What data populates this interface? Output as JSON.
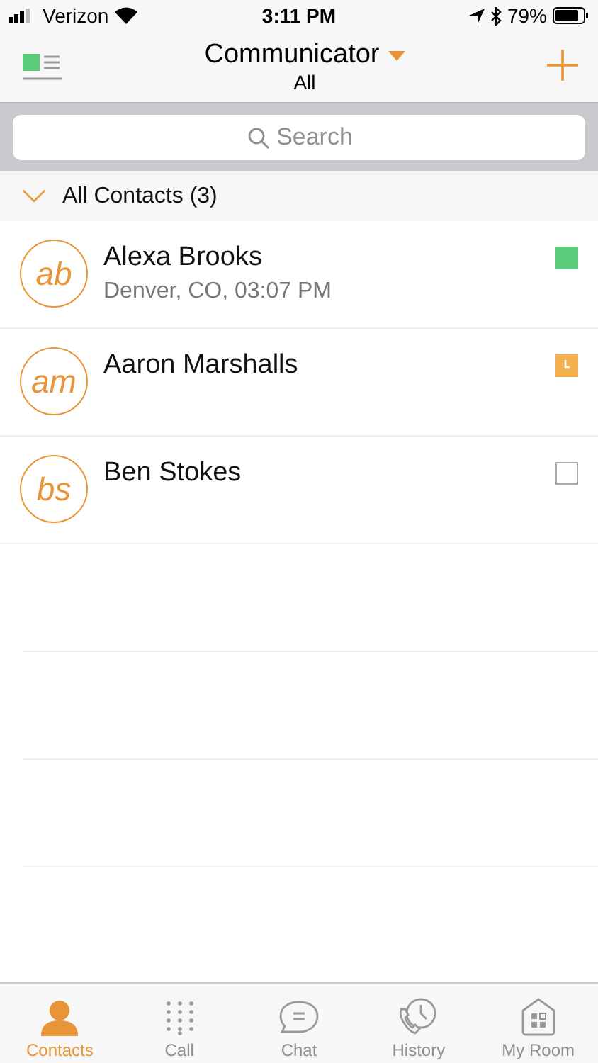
{
  "status_bar": {
    "carrier": "Verizon",
    "time": "3:11 PM",
    "battery": "79%"
  },
  "nav": {
    "title": "Communicator",
    "subtitle": "All"
  },
  "search": {
    "placeholder": "Search"
  },
  "section": {
    "title": "All Contacts (3)",
    "expanded": true
  },
  "contacts": [
    {
      "initials": "ab",
      "name": "Alexa Brooks",
      "detail": "Denver, CO, 03:07 PM",
      "kind": "available"
    },
    {
      "initials": "am",
      "name": "Aaron Marshalls",
      "kind": "away"
    },
    {
      "initials": "bs",
      "name": "Ben Stokes",
      "kind": "offline"
    }
  ],
  "tabs": [
    {
      "label": "Contacts",
      "kind": "contacts",
      "selected": true
    },
    {
      "label": "Call",
      "kind": "call",
      "selected": false
    },
    {
      "label": "Chat",
      "kind": "chat",
      "selected": false
    },
    {
      "label": "History",
      "kind": "history",
      "selected": false
    },
    {
      "label": "My Room",
      "kind": "room",
      "selected": false
    }
  ]
}
